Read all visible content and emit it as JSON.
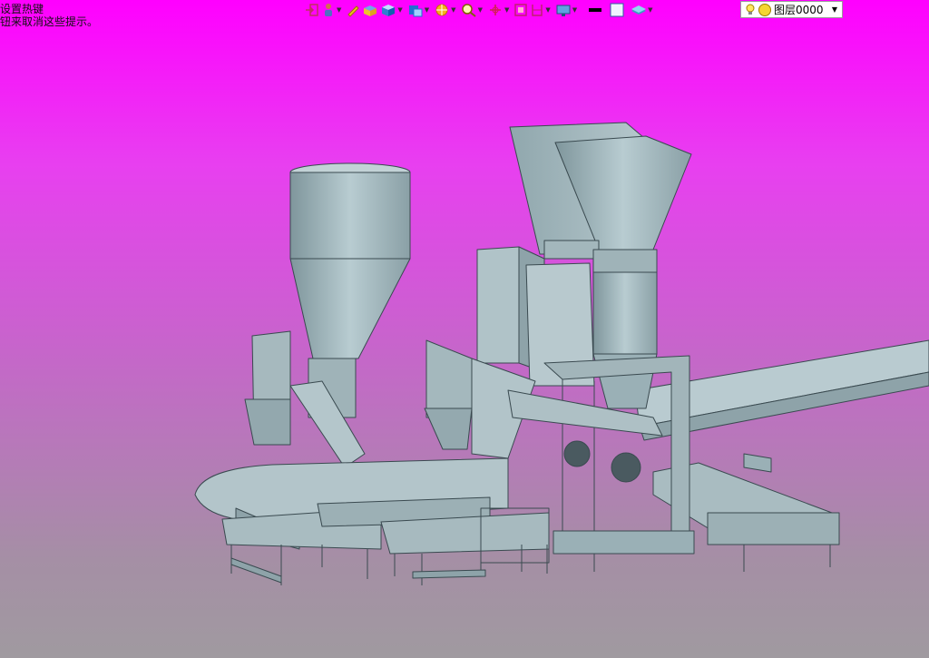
{
  "status_hint": {
    "line1": "设置热键",
    "line2": "钮来取消这些提示。"
  },
  "toolbar": {
    "icons": [
      "exit-icon",
      "person-icon",
      "pencil-icon",
      "box-yellow-icon",
      "cube-icon",
      "cube-face-icon",
      "sun-icon",
      "search-zoom-icon",
      "move-axis-icon",
      "frame-icon",
      "section-icon",
      "display-icon",
      "black-swatch",
      "white-swatch",
      "layers-icon"
    ]
  },
  "layer": {
    "value": "图层0000"
  },
  "colors": {
    "accent": "#ff00ff",
    "machine": "#9bb0b6"
  }
}
